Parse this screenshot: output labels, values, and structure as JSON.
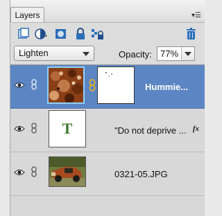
{
  "panel": {
    "tab_label": "Layers",
    "menu_icon": "panel-menu-icon"
  },
  "toolbar": {
    "icons": [
      "new-layer-icon",
      "adjustment-layer-icon",
      "layer-mask-icon",
      "lock-all-icon",
      "lock-transparency-icon",
      "trash-icon"
    ]
  },
  "controls": {
    "blend_mode": "Lighten",
    "opacity_label": "Opacity:",
    "opacity_value": "77%"
  },
  "layers": [
    {
      "name": "Hummie...",
      "selected": true,
      "has_mask": true,
      "thumb_icon": "texture-thumbnail"
    },
    {
      "name": "\"Do not deprive ...",
      "selected": false,
      "has_fx": true,
      "fx_label": "fx",
      "thumb_label": "T"
    },
    {
      "name": "0321-05.JPG",
      "selected": false,
      "thumb_icon": "truck-photo-thumbnail"
    }
  ],
  "colors": {
    "selection": "#5b86c3",
    "text_thumb": "#3b7a2a",
    "accent_blue": "#2d6fb8"
  }
}
